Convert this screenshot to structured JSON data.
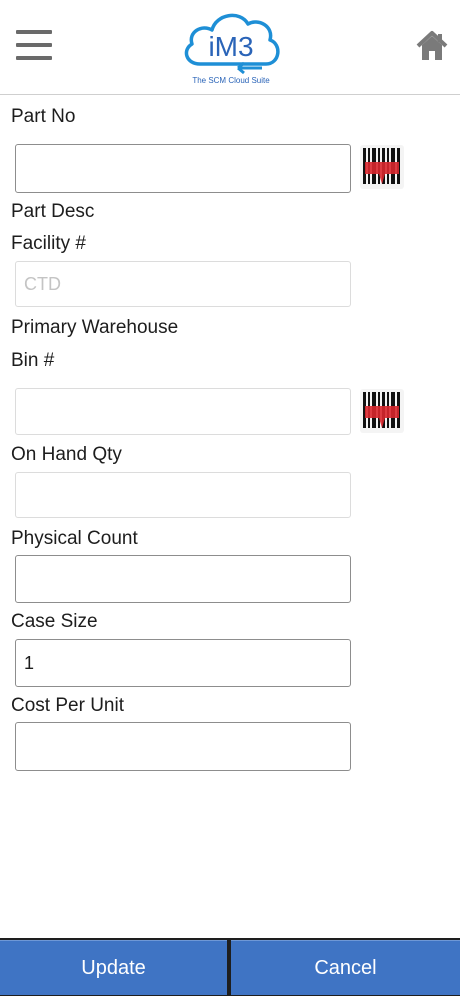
{
  "header": {
    "logo_text": "iM3",
    "tagline": "The SCM Cloud Suite",
    "menu_icon": "hamburger-menu-icon",
    "home_icon": "home-icon"
  },
  "form": {
    "part_no": {
      "label": "Part No",
      "value": ""
    },
    "part_desc": {
      "label": "Part Desc"
    },
    "facility": {
      "label": "Facility #",
      "placeholder": "CTD",
      "value": ""
    },
    "primary_warehouse": {
      "label": "Primary Warehouse"
    },
    "bin": {
      "label": "Bin #",
      "value": ""
    },
    "on_hand_qty": {
      "label": "On Hand Qty",
      "value": ""
    },
    "physical_count": {
      "label": "Physical Count",
      "value": ""
    },
    "case_size": {
      "label": "Case Size",
      "value": "1"
    },
    "cost_per_unit": {
      "label": "Cost Per Unit",
      "value": ""
    },
    "scan_icon": "barcode-scanner-icon"
  },
  "actions": {
    "update_label": "Update",
    "cancel_label": "Cancel"
  },
  "colors": {
    "button_blue": "#3f74c4",
    "scanner_red": "#d9272e",
    "logo_blue": "#1e8fd6"
  }
}
